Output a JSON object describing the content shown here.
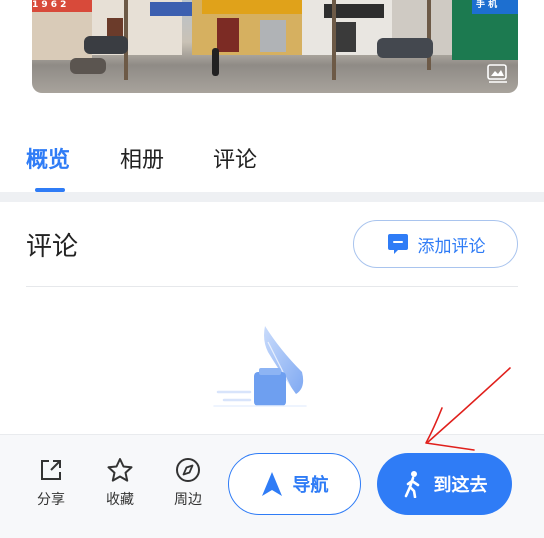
{
  "photo": {
    "signs": [
      "1 9 6 2",
      "手 机"
    ],
    "icon": "photo-gallery-icon"
  },
  "tabs": [
    {
      "label": "概览",
      "active": true
    },
    {
      "label": "相册",
      "active": false
    },
    {
      "label": "评论",
      "active": false
    }
  ],
  "review": {
    "title": "评论",
    "add_label": "添加评论",
    "add_icon": "comment-icon",
    "empty_icon": "quill-ink-icon"
  },
  "bottom": {
    "share_label": "分享",
    "favorite_label": "收藏",
    "nearby_label": "周边",
    "navigate_label": "导航",
    "go_label": "到这去"
  },
  "colors": {
    "accent": "#2f7cf6",
    "annotation": "#e0201c"
  }
}
